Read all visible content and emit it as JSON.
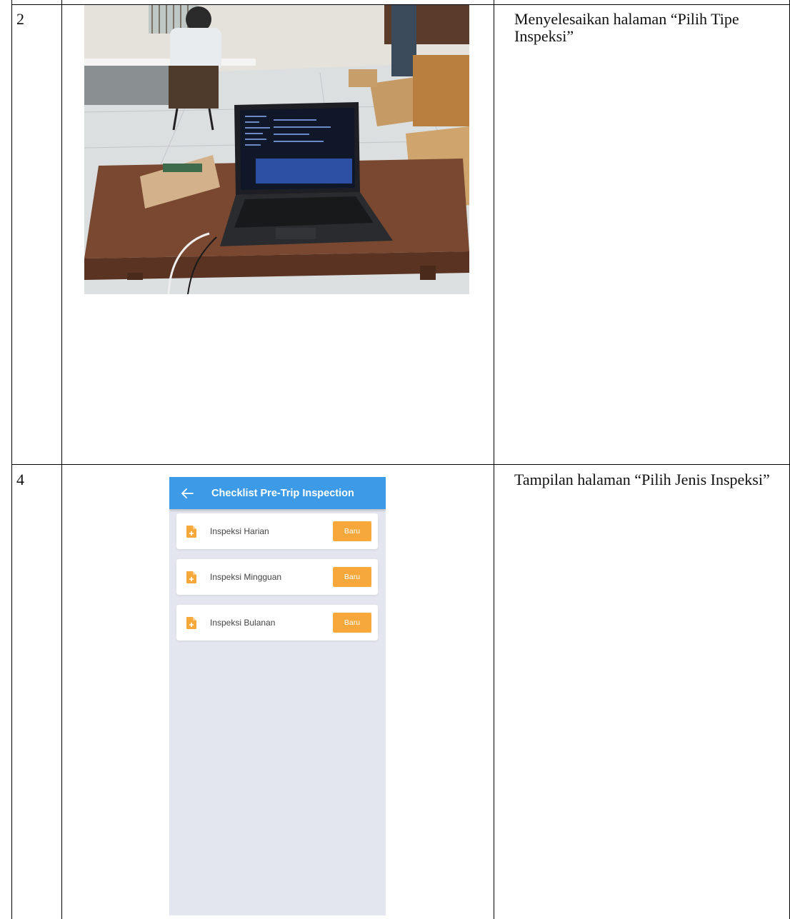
{
  "rows": [
    {
      "number": "2",
      "description": "Menyelesaikan halaman “Pilih Tipe Inspeksi”"
    },
    {
      "number": "4",
      "description": "Tampilan halaman “Pilih Jenis Inspeksi”"
    }
  ],
  "phone": {
    "app_title": "Checklist Pre-Trip Inspection",
    "items": [
      {
        "label": "Inspeksi Harian",
        "button": "Baru"
      },
      {
        "label": "Inspeksi Mingguan",
        "button": "Baru"
      },
      {
        "label": "Inspeksi Bulanan",
        "button": "Baru"
      }
    ],
    "colors": {
      "appbar": "#3d9ae6",
      "button": "#f7a83b",
      "background": "#e3e6ee"
    }
  },
  "icons": {
    "back": "arrow-left-icon",
    "document": "document-plus-icon"
  }
}
